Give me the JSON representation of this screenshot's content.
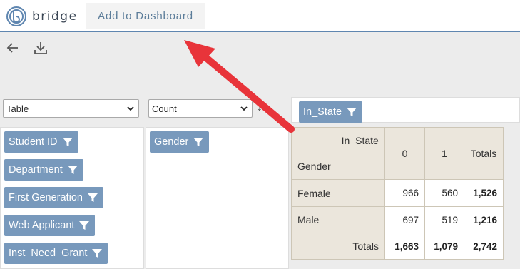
{
  "app": {
    "name": "bridge"
  },
  "header": {
    "tab_label": "Add to Dashboard"
  },
  "toolbar": {
    "back_icon": "arrow-left-icon",
    "download_icon": "download-icon"
  },
  "controls": {
    "renderer_select": {
      "value": "Table"
    },
    "aggregator_select": {
      "value": "Count"
    },
    "swap_glyphs": "↓↔"
  },
  "column_fields": [
    "In_State"
  ],
  "unused_fields": [
    "Student ID",
    "Department",
    "First Generation",
    "Web Applicant",
    "Inst_Need_Grant"
  ],
  "row_fields": [
    "Gender"
  ],
  "pivot": {
    "col_attr": "In_State",
    "row_attr": "Gender",
    "col_values": [
      "0",
      "1"
    ],
    "totals_label": "Totals",
    "rows": [
      {
        "label": "Female",
        "values": [
          "966",
          "560"
        ],
        "total": "1,526"
      },
      {
        "label": "Male",
        "values": [
          "697",
          "519"
        ],
        "total": "1,216"
      }
    ],
    "col_totals": [
      "1,663",
      "1,079"
    ],
    "grand_total": "2,742"
  },
  "colors": {
    "accent": "#5f86b0",
    "pill": "#7899bc",
    "header_bg": "#ebe6dc",
    "annotation_arrow": "#e8343a"
  }
}
